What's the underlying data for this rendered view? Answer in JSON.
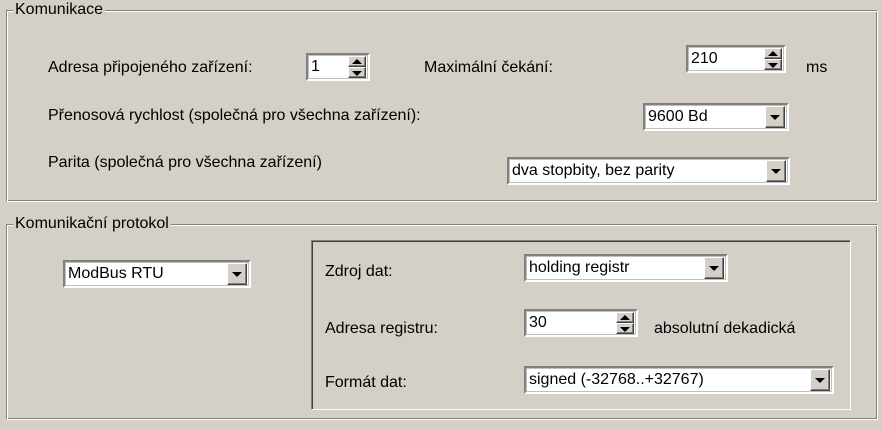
{
  "komunikace": {
    "title": "Komunikace",
    "address_label": "Adresa připojeného zařízení:",
    "address_value": "1",
    "max_wait_label": "Maximální čekání:",
    "max_wait_value": "210",
    "max_wait_unit": "ms",
    "baud_label": "Přenosová rychlost (společná pro všechna zařízení):",
    "baud_value": "9600 Bd",
    "parity_label": "Parita (společná pro všechna zařízení)",
    "parity_value": "dva stopbity, bez parity"
  },
  "protokol": {
    "title": "Komunikační protokol",
    "protocol_value": "ModBus RTU",
    "source_label": "Zdroj dat:",
    "source_value": "holding registr",
    "register_label": "Adresa registru:",
    "register_value": "30",
    "register_note": "absolutní dekadická",
    "format_label": "Formát dat:",
    "format_value": "signed (-32768..+32767)"
  },
  "icons": [
    "spin-up-icon",
    "spin-down-icon",
    "dropdown-arrow-icon"
  ]
}
